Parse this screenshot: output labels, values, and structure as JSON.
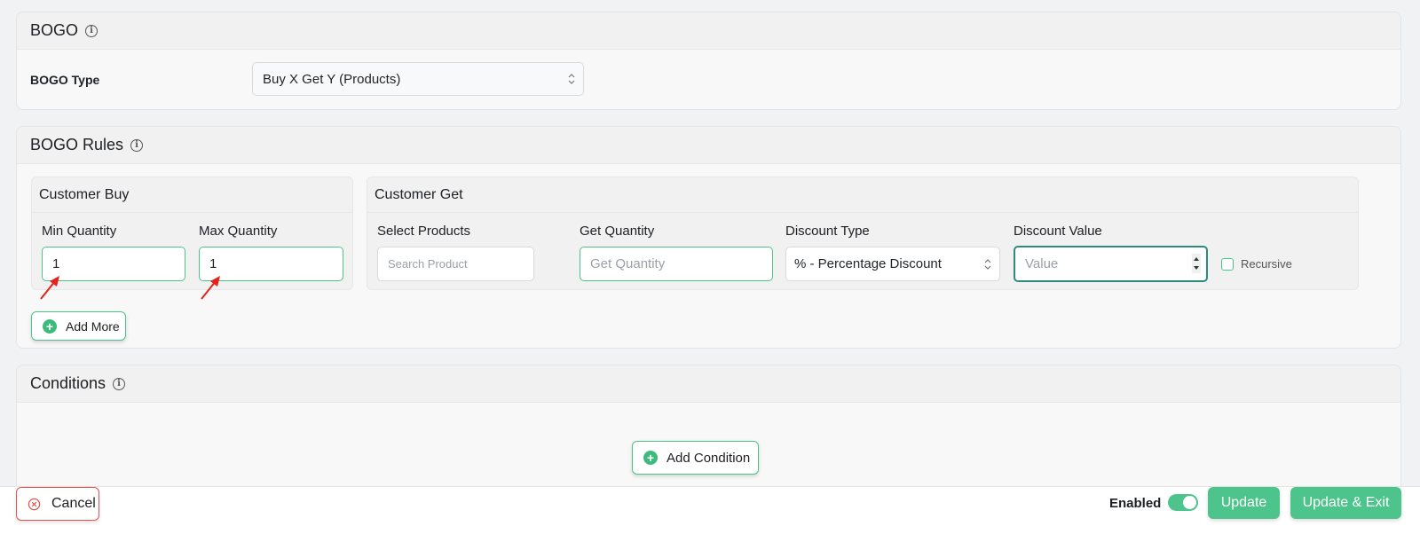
{
  "bogo_section": {
    "title": "BOGO",
    "type_label": "BOGO Type",
    "type_value": "Buy X Get Y (Products)"
  },
  "rules_section": {
    "title": "BOGO Rules",
    "customer_buy": {
      "title": "Customer Buy",
      "min_label": "Min Quantity",
      "min_value": "1",
      "max_label": "Max Quantity",
      "max_value": "1"
    },
    "customer_get": {
      "title": "Customer Get",
      "products_label": "Select Products",
      "products_placeholder": "Search Product",
      "quantity_label": "Get Quantity",
      "quantity_placeholder": "Get Quantity",
      "discount_type_label": "Discount Type",
      "discount_type_value": "% - Percentage Discount",
      "discount_value_label": "Discount Value",
      "discount_value_placeholder": "Value",
      "recursive_label": "Recursive"
    },
    "add_more_label": "Add More"
  },
  "conditions_section": {
    "title": "Conditions",
    "add_condition_label": "Add Condition"
  },
  "footer": {
    "cancel_label": "Cancel",
    "enabled_label": "Enabled",
    "enabled": true,
    "update_label": "Update",
    "update_exit_label": "Update & Exit"
  },
  "colors": {
    "accent_green": "#4dc48b",
    "cancel_red": "#e0534f",
    "annotation_arrow": "#e8201a"
  }
}
